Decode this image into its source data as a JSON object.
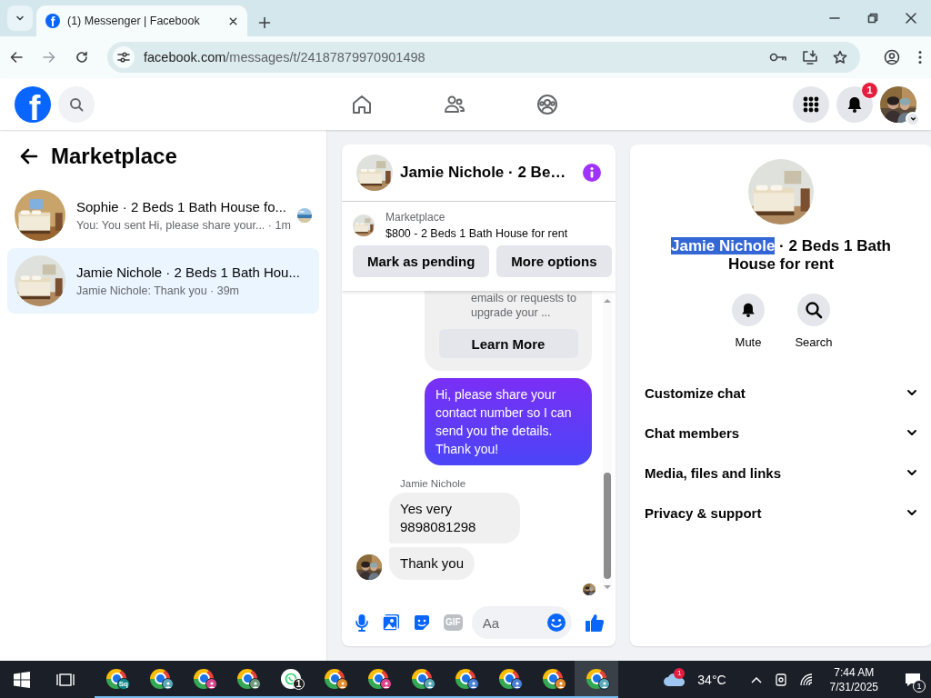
{
  "browser": {
    "tab_title": "(1) Messenger | Facebook",
    "favicon_letter": "f",
    "url_host": "facebook.com",
    "url_path": "/messages/t/24187879970901498"
  },
  "topbar": {
    "logo_letter": "f",
    "nav": [
      {
        "kind": "home"
      },
      {
        "kind": "friends"
      },
      {
        "kind": "groups"
      }
    ],
    "notification_count": "1"
  },
  "chat_list": {
    "title": "Marketplace",
    "chats": [
      {
        "name": "Sophie · 2 Beds 1 Bath House fo...",
        "preview": "You: You sent Hi, please share your... · 1m",
        "selected": false,
        "seen": true
      },
      {
        "name": "Jamie Nichole · 2 Beds 1 Bath Hou...",
        "preview": "Jamie Nichole: Thank you · 39m",
        "selected": true,
        "seen": false
      }
    ]
  },
  "chat": {
    "title": "Jamie Nichole · 2 Be…",
    "listing": {
      "label": "Marketplace",
      "title": "$800 - 2 Beds 1 Bath House for rent",
      "buttons": [
        "Mark as pending",
        "More options"
      ]
    },
    "messages": [
      {
        "kind": "notice",
        "text": "emails or requests to upgrade your ...",
        "button": "Learn More"
      },
      {
        "kind": "outgoing",
        "text": "Hi, please share your contact number so I can send you the details. Thank you!"
      },
      {
        "kind": "sender",
        "text": "Jamie Nichole"
      },
      {
        "kind": "incoming",
        "text": "Yes very 9898081298",
        "avatar": false
      },
      {
        "kind": "incoming",
        "text": "Thank you",
        "avatar": true
      },
      {
        "kind": "seen"
      }
    ],
    "composer": {
      "gif_label": "GIF",
      "placeholder": "Aa"
    }
  },
  "info": {
    "title_selected": "Jamie Nichole",
    "title_rest": " · 2 Beds 1 Bath House for rent",
    "actions": [
      {
        "kind": "mute",
        "label": "Mute"
      },
      {
        "kind": "search",
        "label": "Search"
      }
    ],
    "sections": [
      {
        "label": "Customize chat",
        "expanded": false
      },
      {
        "label": "Chat members",
        "expanded": false
      },
      {
        "label": "Media, files and links",
        "expanded": false
      },
      {
        "label": "Privacy & support",
        "expanded": false
      }
    ]
  },
  "taskbar": {
    "apps": [
      {
        "kind": "browser",
        "badge": "Sq",
        "color": "#0b8a8a",
        "active": false
      },
      {
        "kind": "browser",
        "color": "#5aa8b8",
        "active": false
      },
      {
        "kind": "browser",
        "color": "#d9468c",
        "active": false
      },
      {
        "kind": "browser",
        "color": "#6f9a7c",
        "active": false
      },
      {
        "kind": "chat",
        "badge": "1",
        "active": false
      },
      {
        "kind": "browser",
        "color": "#e08a2c",
        "active": false
      },
      {
        "kind": "browser",
        "color": "#d9468c",
        "active": false
      },
      {
        "kind": "browser",
        "color": "#5aa8b8",
        "active": false
      },
      {
        "kind": "browser",
        "color": "#4a7fd4",
        "active": false
      },
      {
        "kind": "browser",
        "color": "#4a7fd4",
        "active": false
      },
      {
        "kind": "browser",
        "color": "#e08a2c",
        "active": false
      },
      {
        "kind": "browser",
        "color": "#5aa8b8",
        "active": true
      }
    ],
    "weather_badge": "1",
    "temperature": "34°C",
    "time": "7:44 AM",
    "date": "7/31/2025",
    "notification_count": "1"
  }
}
